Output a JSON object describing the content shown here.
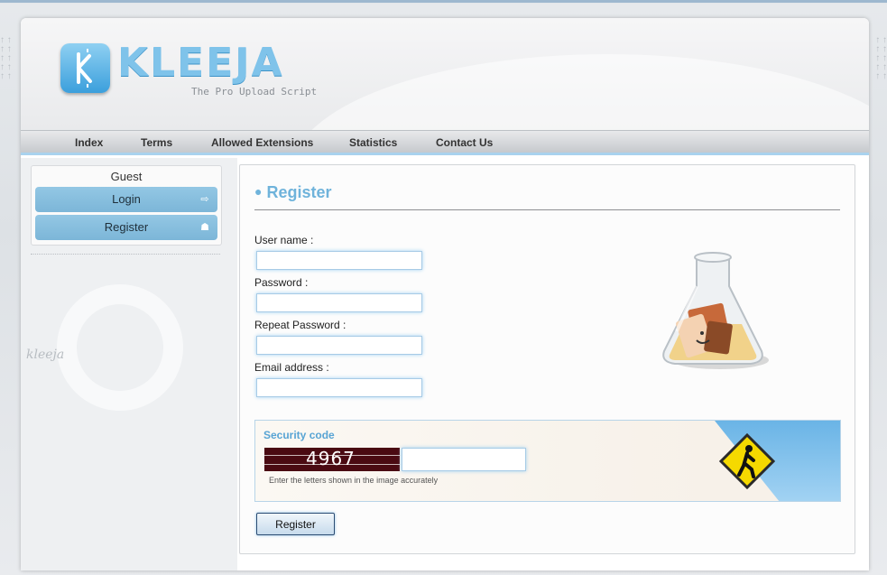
{
  "brand": {
    "name": "KLEEJA",
    "tagline": "The Pro Upload Script",
    "watermark": "kleeja"
  },
  "nav": {
    "items": [
      {
        "label": "Index"
      },
      {
        "label": "Terms"
      },
      {
        "label": "Allowed Extensions"
      },
      {
        "label": "Statistics"
      },
      {
        "label": "Contact Us"
      }
    ]
  },
  "sidebar": {
    "user_status": "Guest",
    "buttons": [
      {
        "label": "Login",
        "icon": "login-icon"
      },
      {
        "label": "Register",
        "icon": "user-add-icon"
      }
    ]
  },
  "main": {
    "title": "Register",
    "fields": [
      {
        "label": "User name :",
        "value": ""
      },
      {
        "label": "Password :",
        "value": ""
      },
      {
        "label": "Repeat Password :",
        "value": ""
      },
      {
        "label": "Email address :",
        "value": ""
      }
    ],
    "security": {
      "title": "Security code",
      "captcha_text": "4967",
      "input_value": "",
      "hint": "Enter the letters shown in the image accurately"
    },
    "submit_label": "Register"
  },
  "colors": {
    "accent": "#7fc3ea",
    "title": "#6fb3db",
    "sidebar_button": "#8cc1e0",
    "captcha_bg": "#4a0a12"
  }
}
